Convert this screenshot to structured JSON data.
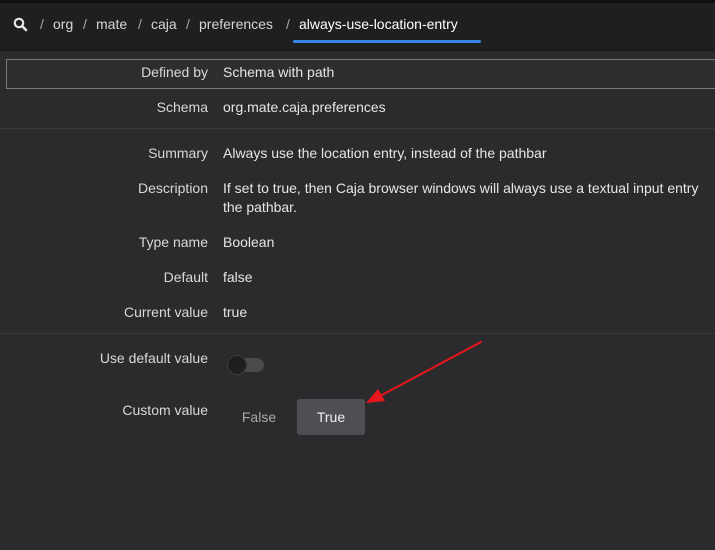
{
  "header": {
    "breadcrumbs": [
      {
        "label": "org"
      },
      {
        "label": "mate"
      },
      {
        "label": "caja"
      },
      {
        "label": "preferences"
      },
      {
        "label": "always-use-location-entry"
      }
    ],
    "separator": "/",
    "accent_color": "#3584e4",
    "search_icon": "search-icon"
  },
  "details": {
    "defined_by": {
      "label": "Defined by",
      "value": "Schema with path"
    },
    "schema": {
      "label": "Schema",
      "value": "org.mate.caja.preferences"
    },
    "summary": {
      "label": "Summary",
      "value": "Always use the location entry, instead of the pathbar"
    },
    "description": {
      "label": "Description",
      "line1": "If set to true, then Caja browser windows will always use a textual input entry",
      "line2": "the pathbar."
    },
    "type_name": {
      "label": "Type name",
      "value": "Boolean"
    },
    "default": {
      "label": "Default",
      "value": "false"
    },
    "current_value": {
      "label": "Current value",
      "value": "true"
    }
  },
  "controls": {
    "use_default_label": "Use default value",
    "use_default_on": false,
    "custom_value_label": "Custom value",
    "option_false": "False",
    "option_true": "True",
    "selected": "True"
  },
  "annotation": {
    "color": "#e8161b"
  }
}
